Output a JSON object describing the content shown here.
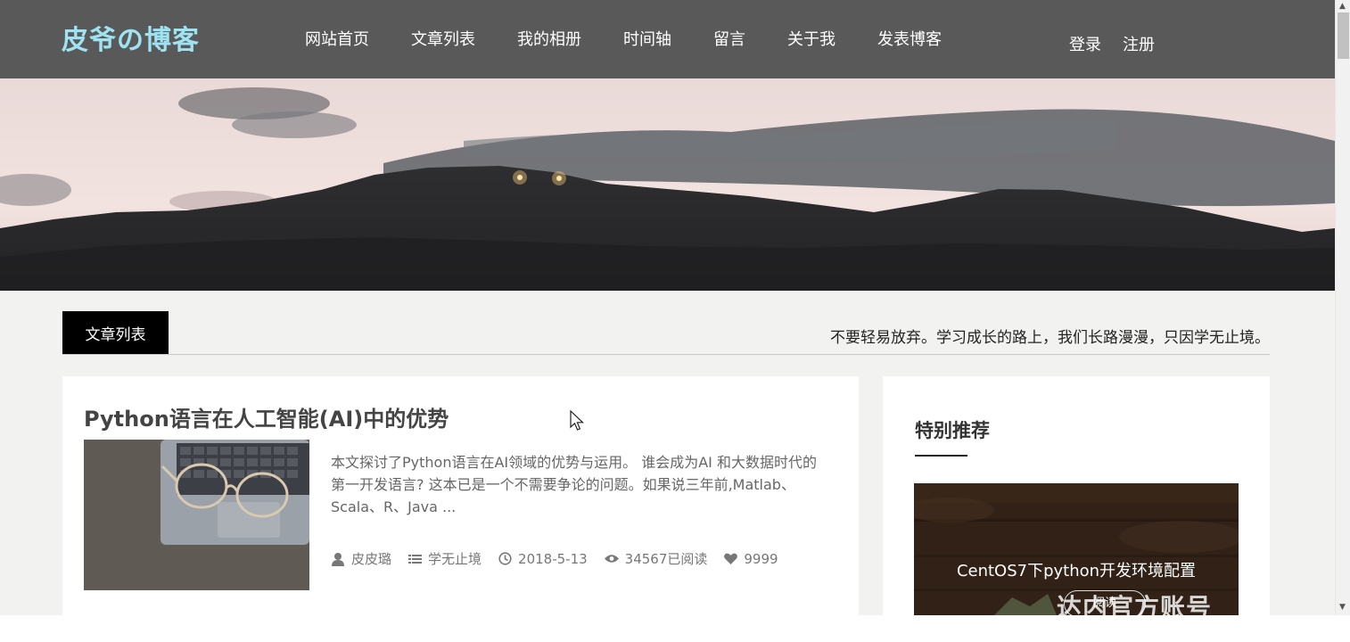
{
  "header": {
    "logo": "皮爷の博客",
    "nav": [
      "网站首页",
      "文章列表",
      "我的相册",
      "时间轴",
      "留言",
      "关于我",
      "发表博客"
    ],
    "login": "登录",
    "register": "注册"
  },
  "section": {
    "active_tab": "文章列表",
    "motto": "不要轻易放弃。学习成长的路上，我们长路漫漫，只因学无止境。"
  },
  "article": {
    "title": "Python语言在人工智能(AI)中的优势",
    "excerpt_lines": [
      "本文探讨了Python语言在AI领域的优势与运用。 谁会成为AI 和大数据时代的",
      "第一开发语言? 这本已是一个不需要争论的问题。如果说三年前,Matlab、",
      "Scala、R、Java ..."
    ],
    "author": "皮皮璐",
    "category": "学无止境",
    "date": "2018-5-13",
    "views": "34567已阅读",
    "likes": "9999"
  },
  "sidebar": {
    "title": "特别推荐",
    "recommend_title": "CentOS7下python开发环境配置",
    "read_button": "阅读"
  },
  "watermark": "达内官方账号",
  "colors": {
    "nav_bg": "#595959",
    "logo": "#9fe3f2",
    "page_bg": "#f2f2f0",
    "active_tab_bg": "#000000"
  },
  "icons": {
    "author": "user-icon",
    "category": "list-icon",
    "date": "clock-icon",
    "views": "eye-icon",
    "likes": "heart-icon"
  }
}
